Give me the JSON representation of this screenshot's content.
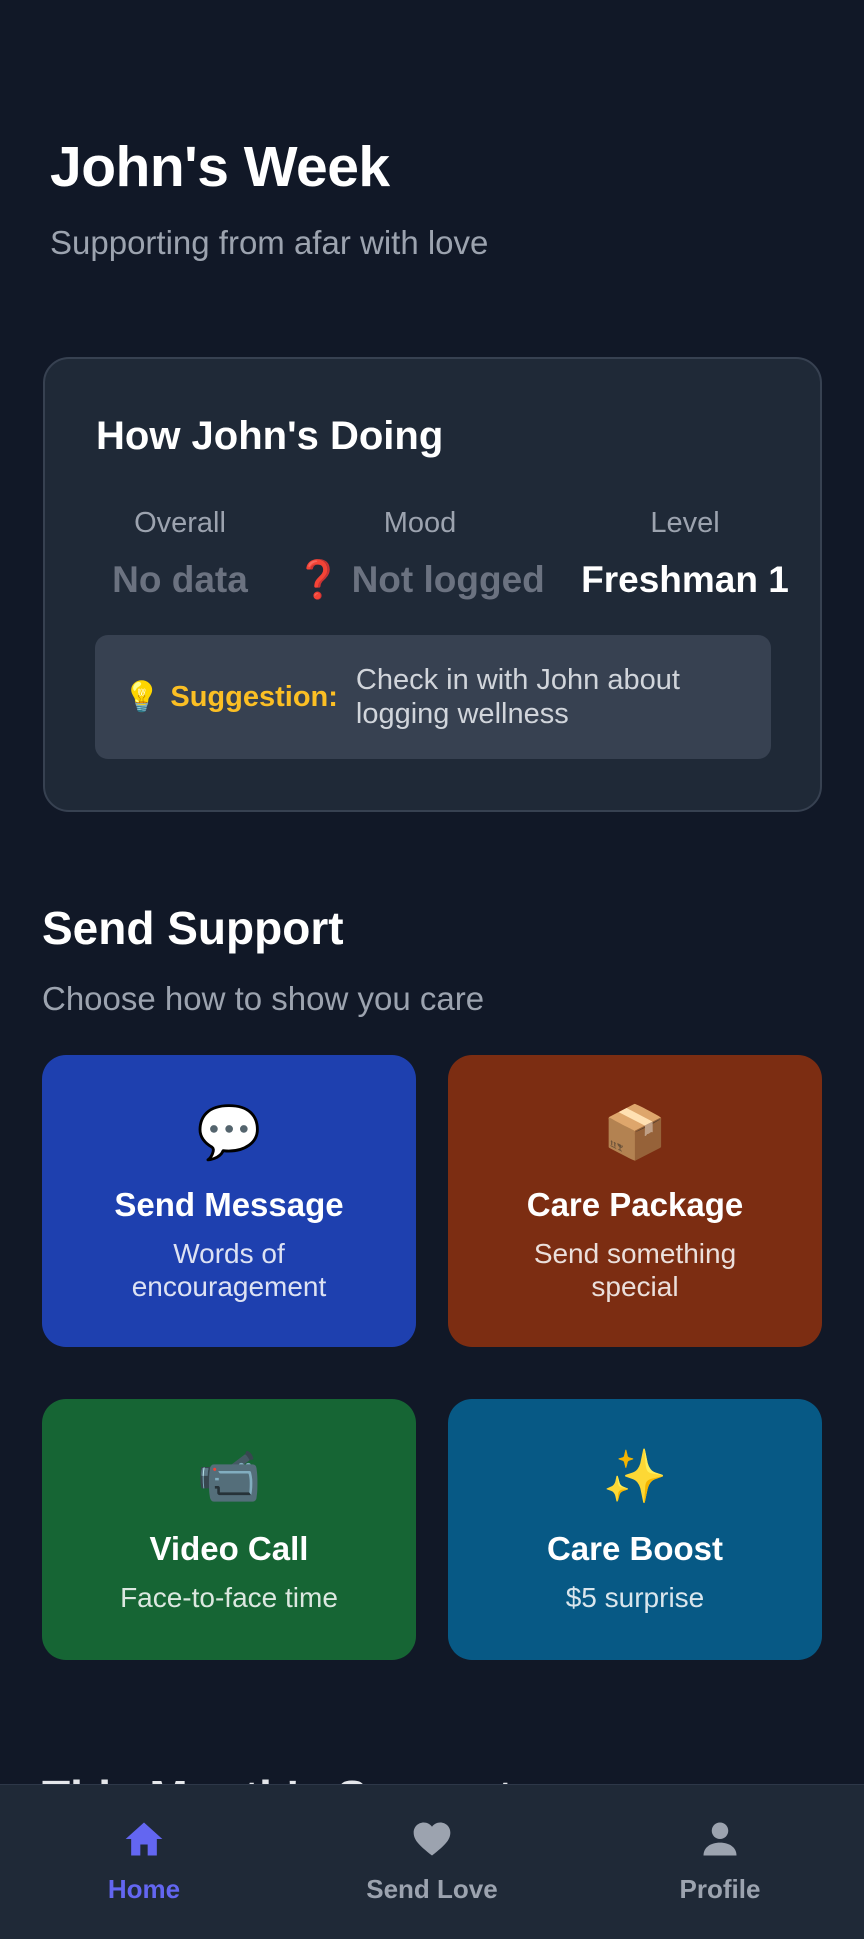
{
  "header": {
    "title": "John's Week",
    "subtitle": "Supporting from afar with love"
  },
  "status": {
    "title": "How John's Doing",
    "metrics": [
      {
        "label": "Overall",
        "value": "No data"
      },
      {
        "label": "Mood",
        "value": "❓ Not logged"
      },
      {
        "label": "Level",
        "value": "Freshman 1"
      }
    ],
    "suggestion": {
      "icon": "💡",
      "label": "Suggestion:",
      "text": "Check in with John about logging wellness"
    }
  },
  "support": {
    "title": "Send Support",
    "subtitle": "Choose how to show you care",
    "options": [
      {
        "icon": "💬",
        "title": "Send Message",
        "subtitle": "Words of encouragement",
        "color": "#1e40af"
      },
      {
        "icon": "📦",
        "title": "Care Package",
        "subtitle": "Send something special",
        "color": "#7c2d12"
      },
      {
        "icon": "📹",
        "title": "Video Call",
        "subtitle": "Face-to-face time",
        "color": "#166534"
      },
      {
        "icon": "✨",
        "title": "Care Boost",
        "subtitle": "$5 surprise",
        "color": "#075985"
      }
    ]
  },
  "next_section": {
    "title": "This Month's Support"
  },
  "nav": {
    "items": [
      {
        "label": "Home",
        "icon": "home-icon",
        "active": true
      },
      {
        "label": "Send Love",
        "icon": "heart-icon",
        "active": false
      },
      {
        "label": "Profile",
        "icon": "person-icon",
        "active": false
      }
    ],
    "active_color": "#6366f1",
    "inactive_color": "#9ca3af"
  }
}
